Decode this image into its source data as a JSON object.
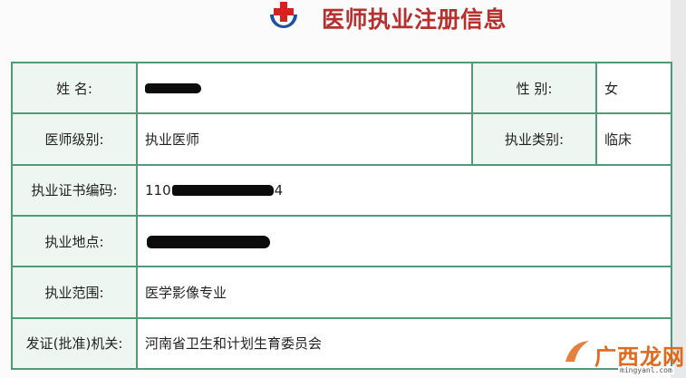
{
  "header": {
    "title": "医师执业注册信息",
    "logo_icon": "red-cross-emblem-icon",
    "logo_colors": {
      "cross": "#d8201e",
      "arc": "#1e4fa0"
    },
    "title_color": "#b8302e"
  },
  "table": {
    "border_color": "#4e9b78",
    "rows": [
      {
        "label": "姓 名:",
        "value_redacted": true,
        "label2": "性 别:",
        "value2": "女"
      },
      {
        "label": "医师级别:",
        "value": "执业医师",
        "label2": "执业类别:",
        "value2": "临床"
      },
      {
        "label": "执业证书编码:",
        "value_prefix": "110",
        "value_suffix": "4",
        "value_redacted": true
      },
      {
        "label": "执业地点:",
        "value_redacted": true
      },
      {
        "label": "执业范围:",
        "value": "医学影像专业"
      },
      {
        "label": "发证(批准)机关:",
        "value": "河南省卫生和计划生育委员会"
      }
    ]
  },
  "watermark": {
    "text": "广西龙网",
    "url": "mingyanl.com",
    "color": "#e06a1c"
  }
}
